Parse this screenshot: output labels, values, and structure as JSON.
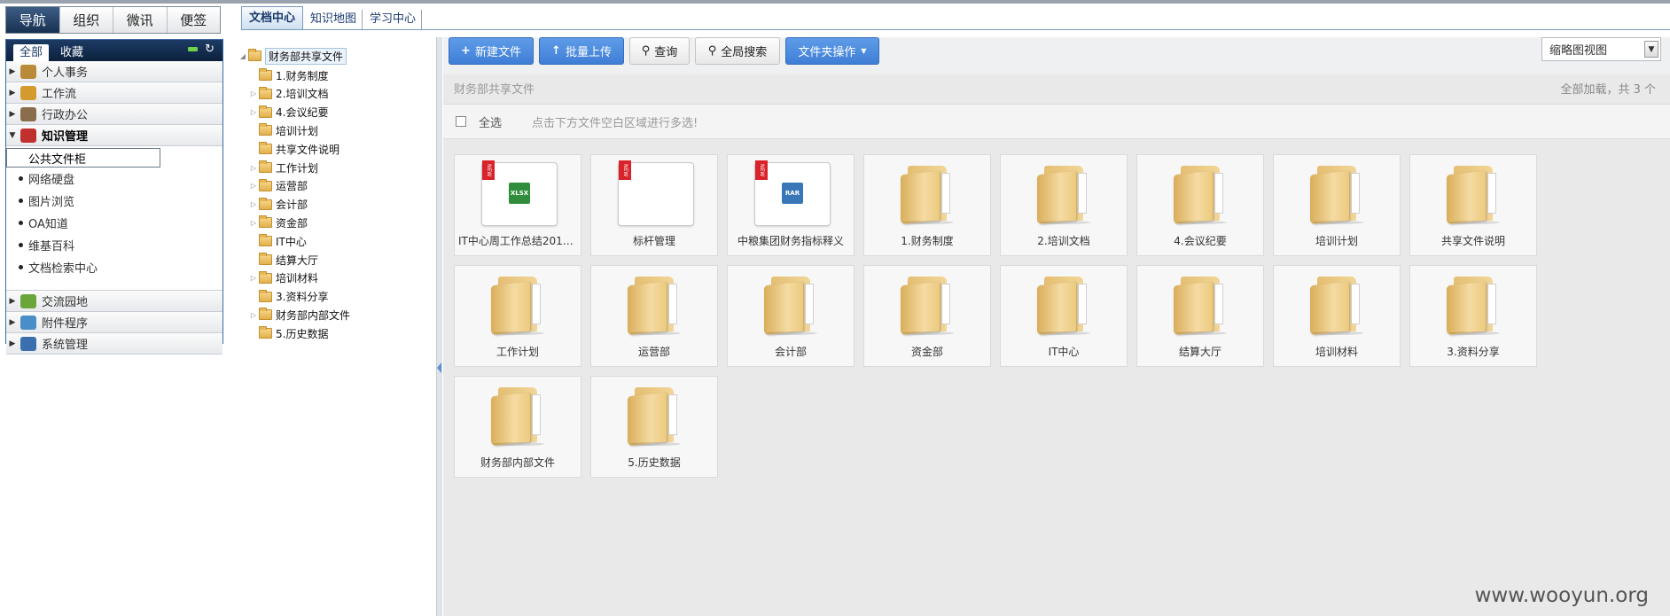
{
  "nav": {
    "top_tabs": [
      "导航",
      "组织",
      "微讯",
      "便签"
    ],
    "sub_tabs": [
      "全部",
      "收藏"
    ],
    "groups_before": [
      {
        "label": "个人事务",
        "color": "#b98a3a"
      },
      {
        "label": "工作流",
        "color": "#d49a2e"
      },
      {
        "label": "行政办公",
        "color": "#8a6d4b"
      }
    ],
    "open_group": {
      "label": "知识管理",
      "color": "#c0302c"
    },
    "current_sub": "公共文件柜",
    "sub_items": [
      "网络硬盘",
      "图片浏览",
      "OA知道",
      "维基百科",
      "文档检索中心"
    ],
    "groups_after": [
      {
        "label": "交流园地",
        "color": "#6aa63a"
      },
      {
        "label": "附件程序",
        "color": "#4a8ec9"
      },
      {
        "label": "系统管理",
        "color": "#3b6fb0"
      }
    ]
  },
  "doc_tabs": [
    "文档中心",
    "知识地图",
    "学习中心"
  ],
  "tree": {
    "root": "财务部共享文件",
    "children": [
      {
        "label": "1.财务制度",
        "expandable": false
      },
      {
        "label": "2.培训文档",
        "expandable": true
      },
      {
        "label": "4.会议纪要",
        "expandable": true
      },
      {
        "label": "培训计划",
        "expandable": false
      },
      {
        "label": "共享文件说明",
        "expandable": false
      },
      {
        "label": "工作计划",
        "expandable": true
      },
      {
        "label": "运营部",
        "expandable": true
      },
      {
        "label": "会计部",
        "expandable": true
      },
      {
        "label": "资金部",
        "expandable": true
      },
      {
        "label": "IT中心",
        "expandable": false
      },
      {
        "label": "结算大厅",
        "expandable": false
      },
      {
        "label": "培训材料",
        "expandable": true
      },
      {
        "label": "3.资料分享",
        "expandable": false
      },
      {
        "label": "财务部内部文件",
        "expandable": true
      },
      {
        "label": "5.历史数据",
        "expandable": false
      }
    ]
  },
  "toolbar": {
    "new_file": "新建文件",
    "batch_upload": "批量上传",
    "query": "查询",
    "global_search": "全局搜索",
    "folder_ops": "文件夹操作",
    "view_mode": "缩略图视图"
  },
  "path": "财务部共享文件",
  "count_text": "全部加载，共 3 个",
  "select": {
    "label": "全选",
    "hint": "点击下方文件空白区域进行多选!"
  },
  "items": [
    {
      "kind": "file",
      "type": "xls",
      "badge": "NEW",
      "type_label": "XLSX",
      "label": "IT中心周工作总结2017..."
    },
    {
      "kind": "file",
      "type": "blank",
      "badge": "NEW",
      "type_label": "",
      "label": "标杆管理"
    },
    {
      "kind": "file",
      "type": "rar",
      "badge": "NEW",
      "type_label": "RAR",
      "label": "中粮集团财务指标释义"
    },
    {
      "kind": "folder",
      "label": "1.财务制度"
    },
    {
      "kind": "folder",
      "label": "2.培训文档"
    },
    {
      "kind": "folder",
      "label": "4.会议纪要"
    },
    {
      "kind": "folder",
      "label": "培训计划"
    },
    {
      "kind": "folder",
      "label": "共享文件说明"
    },
    {
      "kind": "folder",
      "label": "工作计划"
    },
    {
      "kind": "folder",
      "label": "运营部"
    },
    {
      "kind": "folder",
      "label": "会计部"
    },
    {
      "kind": "folder",
      "label": "资金部"
    },
    {
      "kind": "folder",
      "label": "IT中心"
    },
    {
      "kind": "folder",
      "label": "结算大厅"
    },
    {
      "kind": "folder",
      "label": "培训材料"
    },
    {
      "kind": "folder",
      "label": "3.资料分享"
    },
    {
      "kind": "folder",
      "label": "财务部内部文件"
    },
    {
      "kind": "folder",
      "label": "5.历史数据"
    }
  ],
  "watermark": "www.wooyun.org"
}
